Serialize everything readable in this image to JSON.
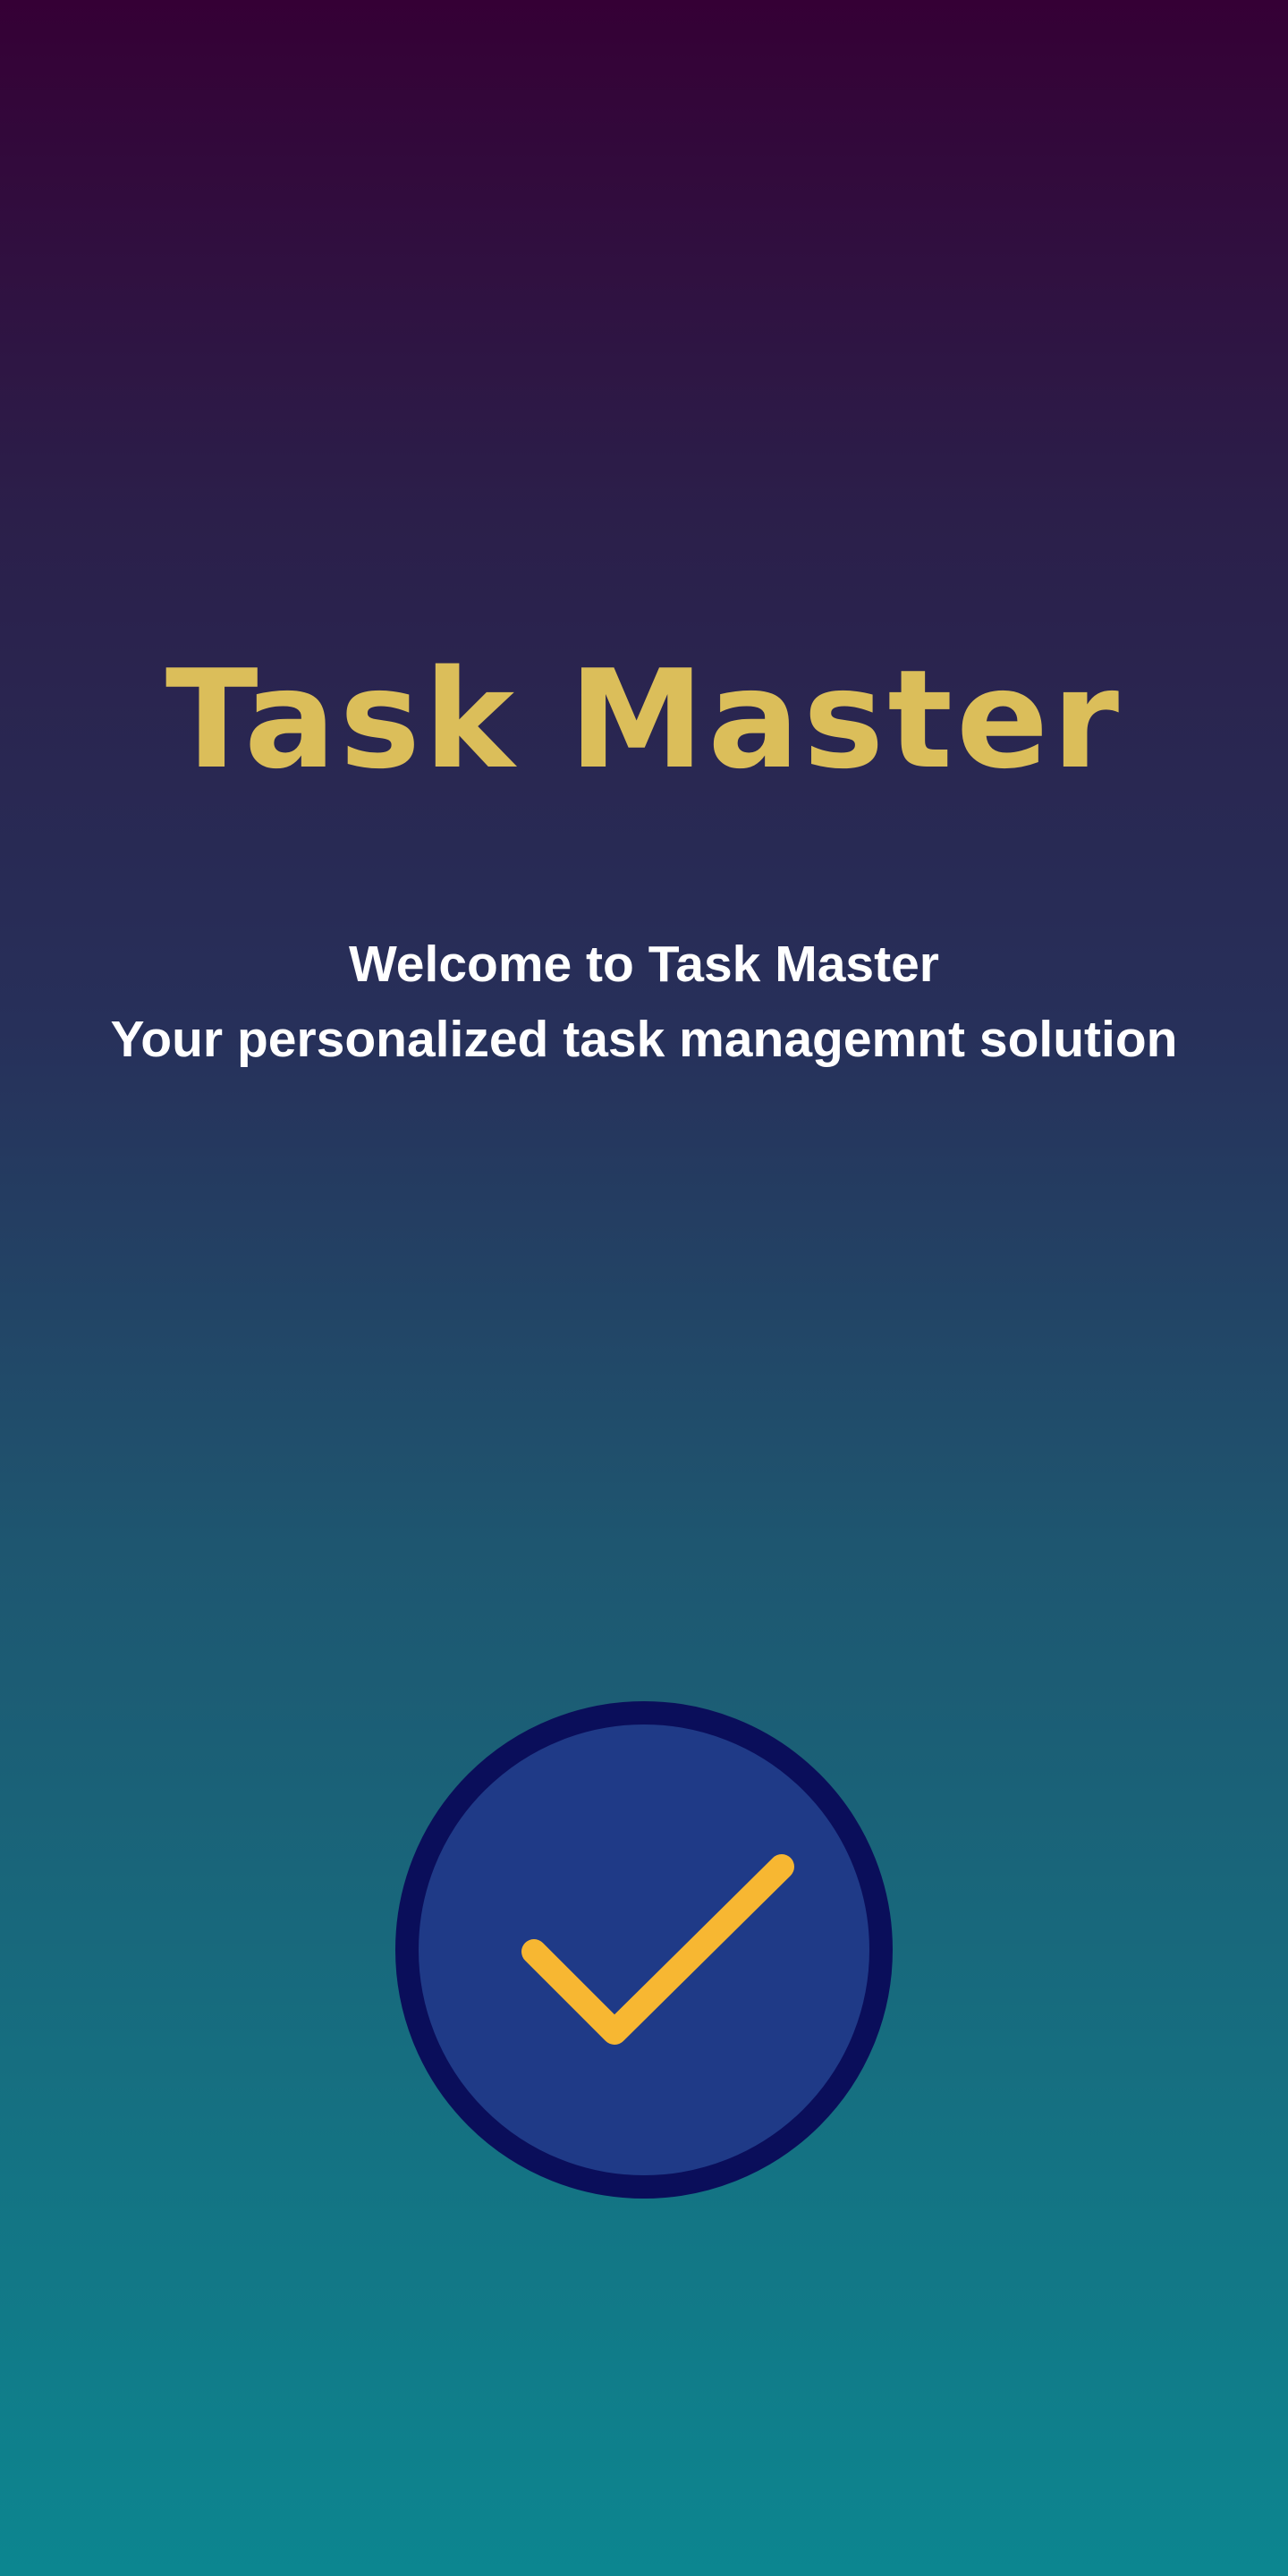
{
  "app": {
    "title": "Task Master"
  },
  "welcome": {
    "line1": "Welcome to Task Master",
    "line2": "Your personalized task managemnt solution"
  },
  "badge": {
    "icon": "checkmark-icon",
    "circle_fill": "#1f3a87",
    "circle_border": "#0a0e5a",
    "check_color": "#f7b732"
  },
  "colors": {
    "title": "#dbbe5a",
    "text": "#ffffff",
    "gradient_top": "#350035",
    "gradient_bottom": "#0c8690"
  }
}
